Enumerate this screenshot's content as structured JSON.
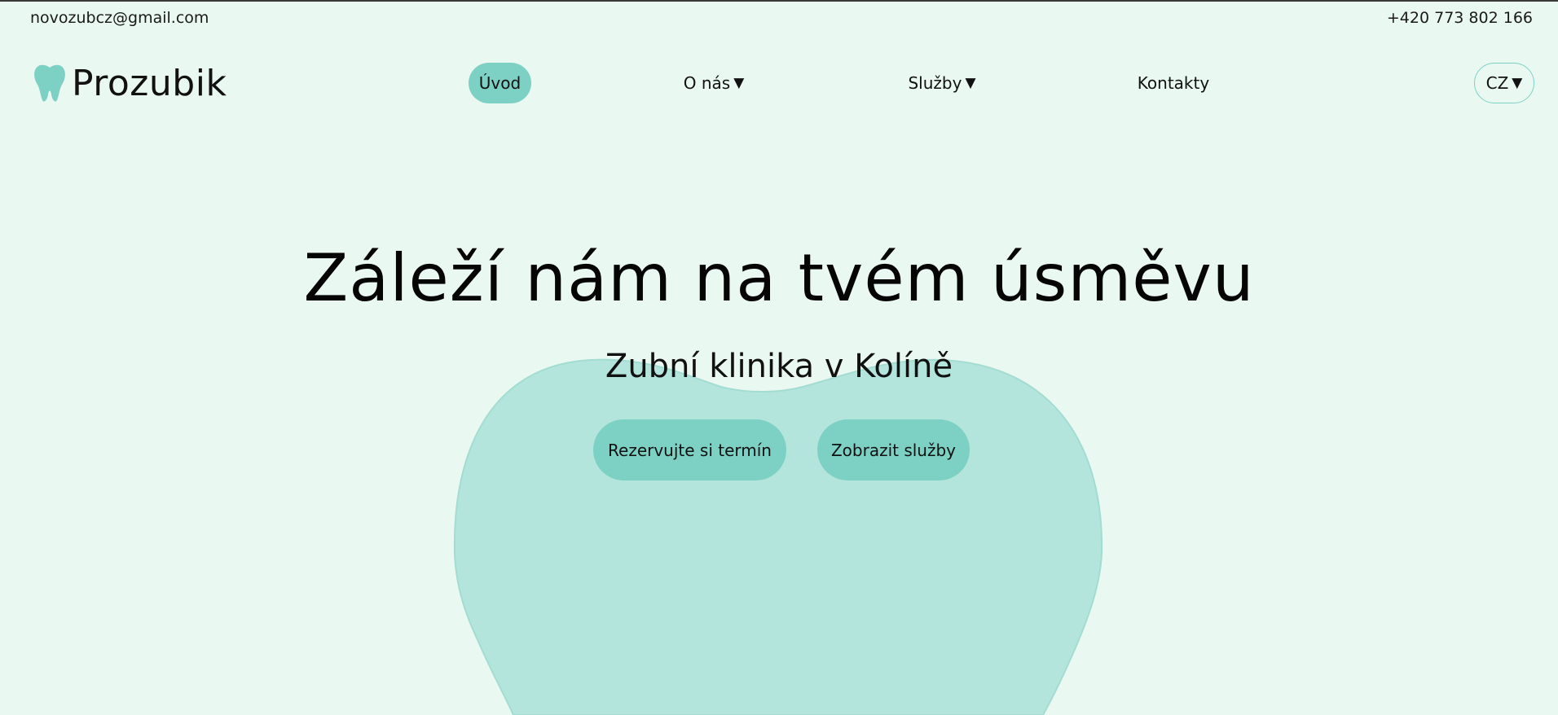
{
  "contact": {
    "email": "novozubcz@gmail.com",
    "phone": "+420 773 802 166"
  },
  "brand": {
    "name": "Prozubik",
    "logo_icon": "tooth-icon",
    "accent_color": "#7dd1c4"
  },
  "nav": {
    "home": "Úvod",
    "about": "O nás",
    "services": "Služby",
    "contacts": "Kontakty",
    "caret": "▼"
  },
  "language": {
    "selected": "CZ"
  },
  "hero": {
    "title": "Záleží nám na tvém úsměvu",
    "subtitle": "Zubní klinika v Kolíně",
    "book_button": "Rezervujte si termín",
    "services_button": "Zobrazit služby"
  },
  "colors": {
    "background": "#eaf8f2",
    "tooth_background": "#b3e5dc"
  }
}
